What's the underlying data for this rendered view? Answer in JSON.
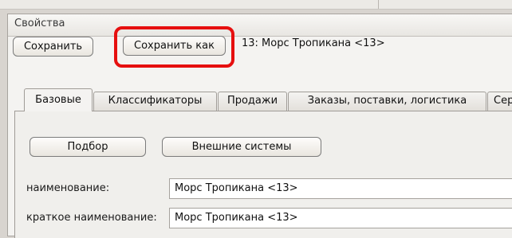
{
  "window": {
    "title": "Свойства"
  },
  "toolbar": {
    "save_label": "Сохранить",
    "save_as_label": "Сохранить как",
    "caption": "13: Морс Тропикана  <13>"
  },
  "tabs": [
    {
      "label": "Базовые",
      "active": true
    },
    {
      "label": "Классификаторы",
      "active": false
    },
    {
      "label": "Продажи",
      "active": false
    },
    {
      "label": "Заказы, поставки, логистика",
      "active": false
    },
    {
      "label": "Сер",
      "active": false
    }
  ],
  "actions": {
    "pick_label": "Подбор",
    "external_label": "Внешние системы"
  },
  "fields": [
    {
      "label": "наименование:",
      "value": "Морс Тропикана  <13>"
    },
    {
      "label": "краткое наименование:",
      "value": "Морс Тропикана  <13>"
    }
  ],
  "colors": {
    "highlight": "#e60f0f",
    "window_bg": "#f4f3f1"
  }
}
